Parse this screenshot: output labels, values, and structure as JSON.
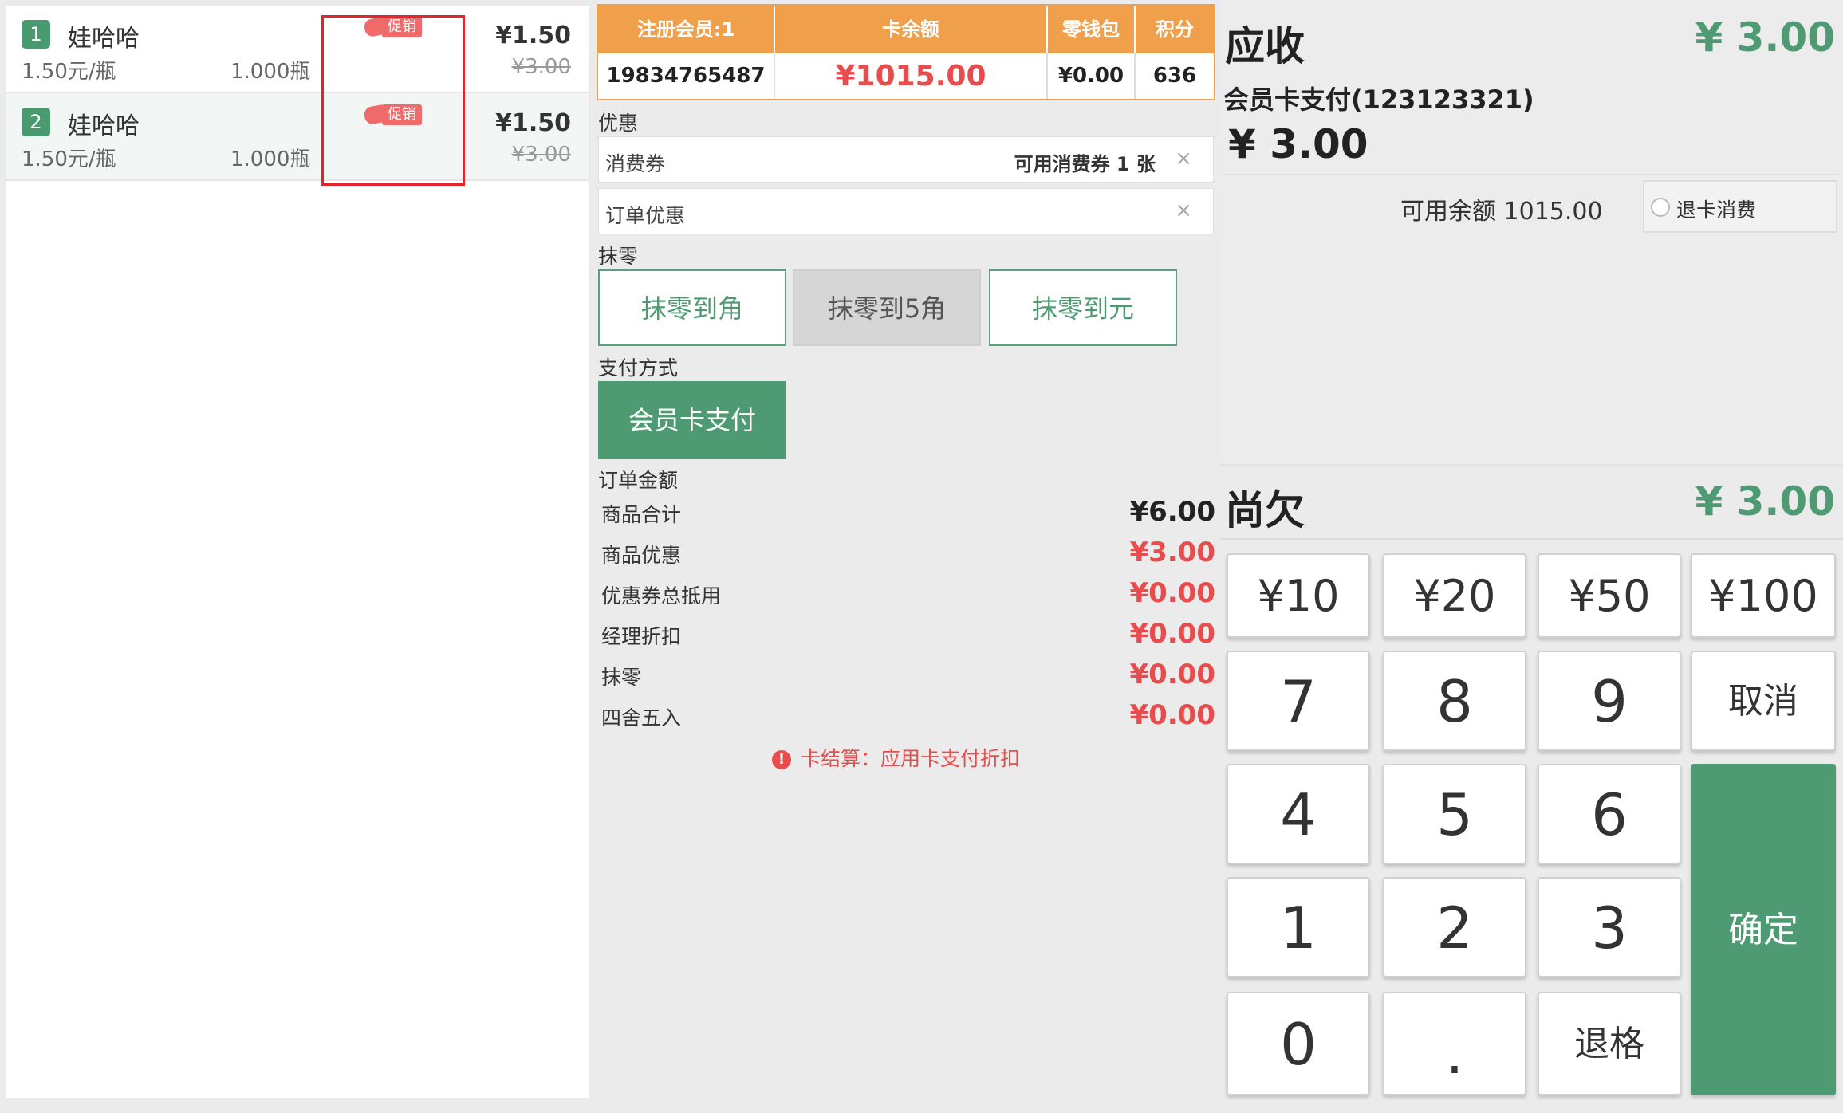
{
  "items": [
    {
      "index": "1",
      "name": "娃哈哈",
      "unit_price": "1.50元/瓶",
      "quantity": "1.000瓶",
      "price": "¥1.50",
      "original_price": "¥3.00",
      "promo": "促销"
    },
    {
      "index": "2",
      "name": "娃哈哈",
      "unit_price": "1.50元/瓶",
      "quantity": "1.000瓶",
      "price": "¥1.50",
      "original_price": "¥3.00",
      "promo": "促销"
    }
  ],
  "member": {
    "headers": [
      "注册会员:1",
      "卡余额",
      "零钱包",
      "积分"
    ],
    "phone": "19834765487",
    "card_balance": "¥1015.00",
    "wallet": "¥0.00",
    "points": "636"
  },
  "discount": {
    "label": "优惠",
    "coupon_label": "消费券",
    "coupon_available": "可用消费券 1 张",
    "order_discount_label": "订单优惠",
    "clear_icon": "×"
  },
  "rounding": {
    "label": "抹零",
    "options": [
      "抹零到角",
      "抹零到5角",
      "抹零到元"
    ]
  },
  "payment": {
    "label": "支付方式",
    "method": "会员卡支付"
  },
  "order_amount": {
    "label": "订单金额",
    "rows": [
      {
        "key": "商品合计",
        "value": "¥6.00"
      },
      {
        "key": "商品优惠",
        "value": "¥3.00"
      },
      {
        "key": "优惠券总抵用",
        "value": "¥0.00"
      },
      {
        "key": "经理折扣",
        "value": "¥0.00"
      },
      {
        "key": "抹零",
        "value": "¥0.00"
      },
      {
        "key": "四舍五入",
        "value": "¥0.00"
      }
    ],
    "note": "卡结算：应用卡支付折扣"
  },
  "receivable": {
    "label": "应收",
    "value": "¥ 3.00",
    "card_pay_label": "会员卡支付(123123321)",
    "card_pay_value": "¥ 3.00",
    "available_balance": "可用余额 1015.00",
    "refund_label": "退卡消费"
  },
  "owed": {
    "label": "尚欠",
    "value": "¥ 3.00"
  },
  "keypad": {
    "amounts": [
      "¥10",
      "¥20",
      "¥50",
      "¥100"
    ],
    "row7": [
      "7",
      "8",
      "9"
    ],
    "row4": [
      "4",
      "5",
      "6"
    ],
    "row1": [
      "1",
      "2",
      "3"
    ],
    "zero": "0",
    "dot": ".",
    "backspace": "退格",
    "cancel": "取消",
    "confirm": "确定"
  },
  "colors": {
    "accent_green": "#4e9a72",
    "header_orange": "#f0a04b",
    "alert_red": "#e84c4c"
  }
}
